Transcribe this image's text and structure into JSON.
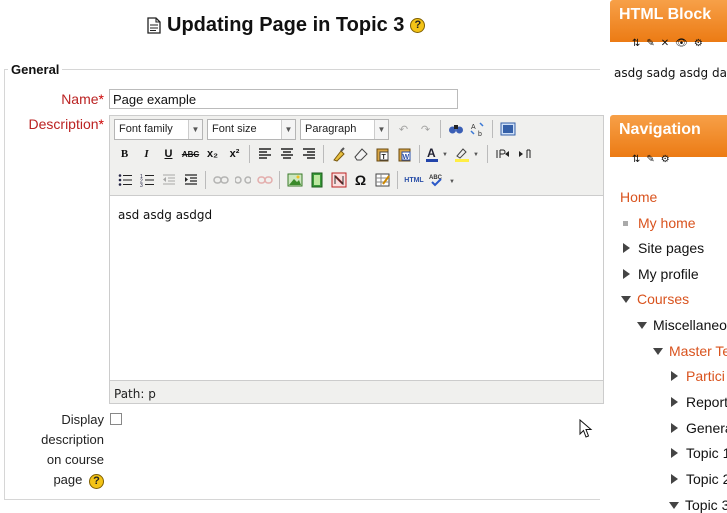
{
  "page": {
    "title": "Updating Page in Topic 3",
    "help_glyph": "?"
  },
  "form": {
    "legend": "General",
    "name_label": "Name",
    "required_mark": "*",
    "name_value": "Page example",
    "description_label": "Description",
    "display_label_lines": [
      "Display",
      "description",
      "on course",
      "page"
    ]
  },
  "editor": {
    "font_family": "Font family",
    "font_size": "Font size",
    "format": "Paragraph",
    "content": "asd asdg asdgd",
    "path": "Path: p",
    "toolbar_icons": [
      "undo-icon",
      "redo-icon",
      "find-icon",
      "replace-icon",
      "fullscreen-icon",
      "bold-icon",
      "italic-icon",
      "underline-icon",
      "strikethrough-icon",
      "subscript-icon",
      "superscript-icon",
      "align-left-icon",
      "align-center-icon",
      "align-right-icon",
      "cleanup-icon",
      "eraser-icon",
      "paste-text-icon",
      "paste-word-icon",
      "text-color-icon",
      "highlight-icon",
      "ltr-icon",
      "rtl-icon",
      "bullet-list-icon",
      "numbered-list-icon",
      "outdent-icon",
      "indent-icon",
      "link-icon",
      "unlink-icon",
      "anchor-icon",
      "image-icon",
      "media-icon",
      "no-autolink-icon",
      "special-char-icon",
      "table-icon",
      "html-source-icon",
      "spellcheck-icon"
    ],
    "bold_glyph": "B",
    "italic_glyph": "I",
    "underline_glyph": "U",
    "strike_glyph": "ABC",
    "sub_glyph": "x₂",
    "sup_glyph": "x²",
    "omega_glyph": "Ω",
    "html_glyph": "HTML"
  },
  "html_block": {
    "title": "HTML Block",
    "content": "asdg sadg asdg das"
  },
  "navigation": {
    "title": "Navigation",
    "items": [
      {
        "label": "Home",
        "style": "link"
      },
      {
        "label": "My home",
        "style": "link"
      },
      {
        "label": "Site pages",
        "style": "plain"
      },
      {
        "label": "My profile",
        "style": "plain"
      },
      {
        "label": "Courses",
        "style": "link"
      },
      {
        "label": "Miscellaneo",
        "style": "plain"
      },
      {
        "label": "Master Te",
        "style": "link"
      },
      {
        "label": "Partici",
        "style": "link"
      },
      {
        "label": "Report",
        "style": "plain"
      },
      {
        "label": "Genera",
        "style": "plain"
      },
      {
        "label": "Topic 1",
        "style": "plain"
      },
      {
        "label": "Topic 2",
        "style": "plain"
      },
      {
        "label": "Topic 3",
        "style": "plain"
      }
    ]
  },
  "colors": {
    "block_header": "#ec7b14",
    "required": "#cc0000",
    "link": "#d9531e"
  }
}
